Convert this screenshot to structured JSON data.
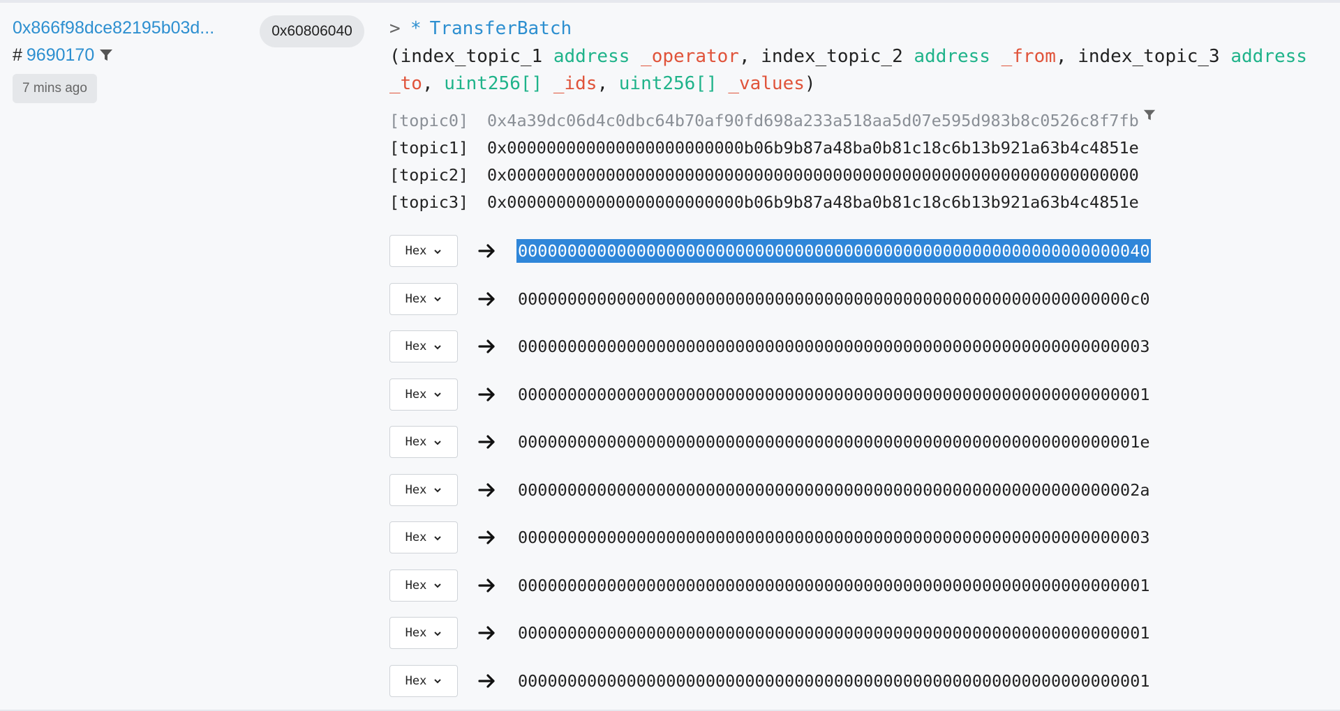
{
  "log": {
    "address": "0x866f98dce82195b03d...",
    "block_prefix": "#",
    "block": "9690170",
    "time": "7 mins ago",
    "selector": "0x60806040"
  },
  "event": {
    "chevron": ">",
    "star": "*",
    "name": "TransferBatch",
    "signature": [
      {
        "text": "(",
        "role": "punct"
      },
      {
        "text": "index_topic_1 ",
        "role": "plain"
      },
      {
        "text": "address ",
        "role": "type"
      },
      {
        "text": "_operator",
        "role": "param"
      },
      {
        "text": ", index_topic_2 ",
        "role": "plain"
      },
      {
        "text": "address ",
        "role": "type"
      },
      {
        "text": "_from",
        "role": "param"
      },
      {
        "text": ", index_topic_3 ",
        "role": "plain"
      },
      {
        "text": "address ",
        "role": "type"
      },
      {
        "text": "_to",
        "role": "param"
      },
      {
        "text": ", ",
        "role": "plain"
      },
      {
        "text": "uint256[] ",
        "role": "type"
      },
      {
        "text": "_ids",
        "role": "param"
      },
      {
        "text": ", ",
        "role": "plain"
      },
      {
        "text": "uint256[] ",
        "role": "type"
      },
      {
        "text": "_values",
        "role": "param"
      },
      {
        "text": ")",
        "role": "punct"
      }
    ]
  },
  "topics": [
    {
      "label": "[topic0]",
      "value": "0x4a39dc06d4c0dbc64b70af90fd698a233a518aa5d07e595d983b8c0526c8f7fb"
    },
    {
      "label": "[topic1]",
      "value": "0x000000000000000000000000b06b9b87a48ba0b81c18c6b13b921a63b4c4851e"
    },
    {
      "label": "[topic2]",
      "value": "0x0000000000000000000000000000000000000000000000000000000000000000"
    },
    {
      "label": "[topic3]",
      "value": "0x000000000000000000000000b06b9b87a48ba0b81c18c6b13b921a63b4c4851e"
    }
  ],
  "data_rows": [
    {
      "format": "Hex",
      "value": "0000000000000000000000000000000000000000000000000000000000000040"
    },
    {
      "format": "Hex",
      "value": "00000000000000000000000000000000000000000000000000000000000000c0"
    },
    {
      "format": "Hex",
      "value": "0000000000000000000000000000000000000000000000000000000000000003"
    },
    {
      "format": "Hex",
      "value": "0000000000000000000000000000000000000000000000000000000000000001"
    },
    {
      "format": "Hex",
      "value": "000000000000000000000000000000000000000000000000000000000000001e"
    },
    {
      "format": "Hex",
      "value": "000000000000000000000000000000000000000000000000000000000000002a"
    },
    {
      "format": "Hex",
      "value": "0000000000000000000000000000000000000000000000000000000000000003"
    },
    {
      "format": "Hex",
      "value": "0000000000000000000000000000000000000000000000000000000000000001"
    },
    {
      "format": "Hex",
      "value": "0000000000000000000000000000000000000000000000000000000000000001"
    },
    {
      "format": "Hex",
      "value": "0000000000000000000000000000000000000000000000000000000000000001"
    }
  ],
  "colors": {
    "link": "#2d8fd0",
    "type_keyword": "#1fb38a",
    "param_name": "#e0533a",
    "selection": "#2f86d9"
  },
  "icons": {
    "filter": "filter-icon",
    "arrow": "arrow-right-icon",
    "dropdown": "chevron-down-icon"
  }
}
